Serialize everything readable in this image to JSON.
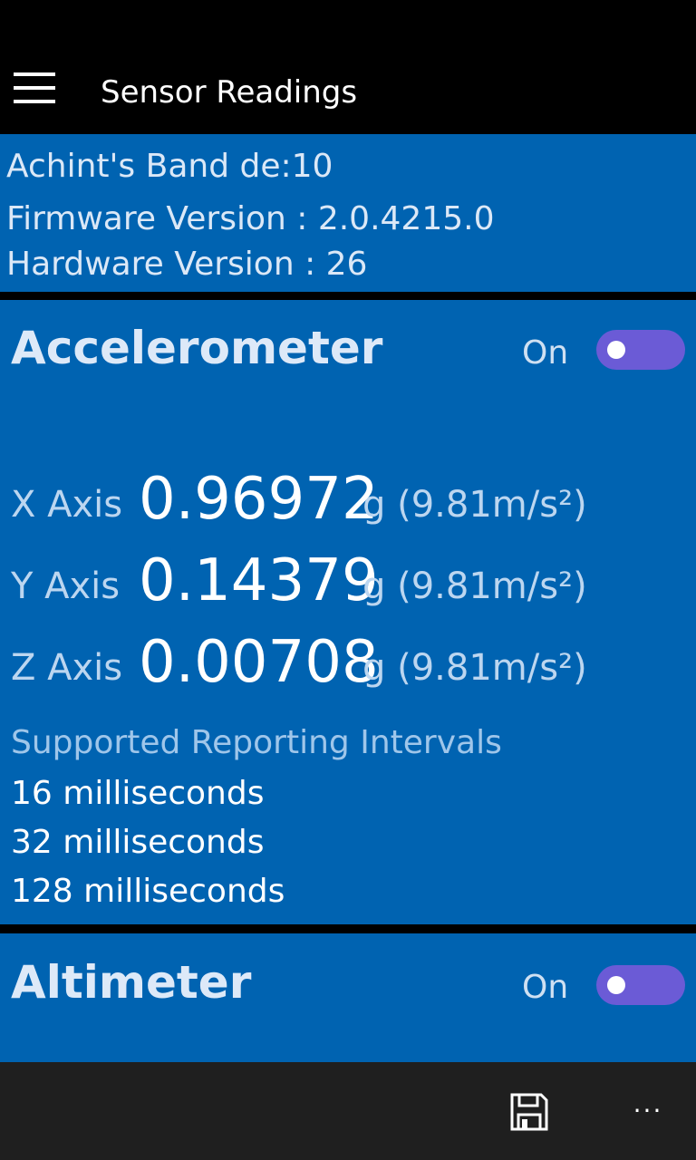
{
  "header": {
    "menu_icon": "hamburger-icon",
    "title": "Sensor Readings"
  },
  "device": {
    "name": "Achint's Band de:10",
    "firmware": "Firmware Version : 2.0.4215.0",
    "hardware": "Hardware Version : 26"
  },
  "accelerometer": {
    "title": "Accelerometer",
    "toggle_label": "On",
    "axes": [
      {
        "label": "X Axis",
        "value": "0.96972",
        "unit": "g (9.81m/s²)"
      },
      {
        "label": "Y Axis",
        "value": "0.14379",
        "unit": "g (9.81m/s²)"
      },
      {
        "label": "Z Axis",
        "value": "0.00708",
        "unit": "g (9.81m/s²)"
      }
    ],
    "intervals_title": "Supported Reporting Intervals",
    "intervals": [
      "16 milliseconds",
      "32 milliseconds",
      "128 milliseconds"
    ]
  },
  "altimeter": {
    "title": "Altimeter",
    "toggle_label": "On"
  },
  "app_bar": {
    "save_icon": "save-icon",
    "more_label": "···"
  },
  "colors": {
    "panel": "#0063b1",
    "toggle_track": "#6b5bd6",
    "background": "#000000",
    "app_bar": "#1f1f1f"
  }
}
